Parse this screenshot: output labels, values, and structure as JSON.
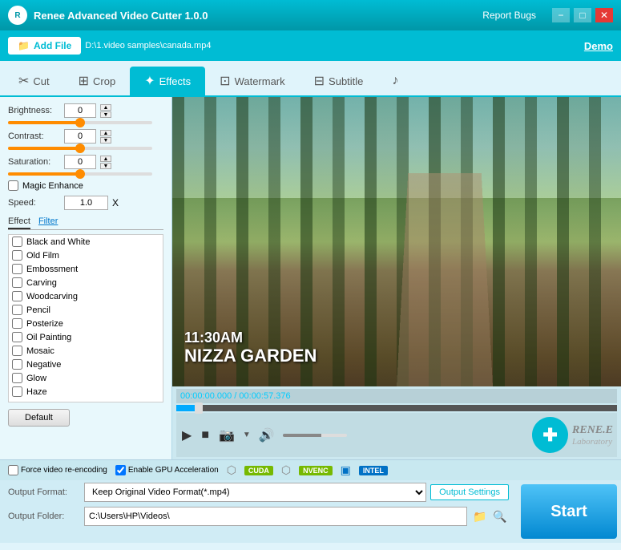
{
  "titlebar": {
    "logo": "R",
    "title": "Renee Advanced Video Cutter 1.0.0",
    "report_bugs": "Report Bugs",
    "minimize": "−",
    "maximize": "□",
    "close": "✕"
  },
  "actionbar": {
    "add_file_label": "Add File",
    "file_path": "D:\\1.video samples\\canada.mp4",
    "demo_label": "Demo"
  },
  "tabs": [
    {
      "id": "cut",
      "label": "Cut",
      "icon": "✂"
    },
    {
      "id": "crop",
      "label": "Crop",
      "icon": "⊞"
    },
    {
      "id": "effects",
      "label": "Effects",
      "icon": "✦",
      "active": true
    },
    {
      "id": "watermark",
      "label": "Watermark",
      "icon": "⊡"
    },
    {
      "id": "subtitle",
      "label": "Subtitle",
      "icon": "⊟"
    },
    {
      "id": "music",
      "label": "",
      "icon": "♪"
    }
  ],
  "left_panel": {
    "brightness": {
      "label": "Brightness:",
      "value": "0"
    },
    "contrast": {
      "label": "Contrast:",
      "value": "0"
    },
    "saturation": {
      "label": "Saturation:",
      "value": "0"
    },
    "magic_enhance": {
      "label": "Magic Enhance",
      "checked": false
    },
    "speed": {
      "label": "Speed:",
      "value": "1.0",
      "unit": "X"
    },
    "effect_tab": "Effect",
    "filter_tab": "Filter",
    "effects_list": [
      {
        "id": "black-white",
        "label": "Black and White",
        "checked": false
      },
      {
        "id": "old-film",
        "label": "Old Film",
        "checked": false
      },
      {
        "id": "embossment",
        "label": "Embossment",
        "checked": false
      },
      {
        "id": "carving",
        "label": "Carving",
        "checked": false
      },
      {
        "id": "woodcarving",
        "label": "Woodcarving",
        "checked": false
      },
      {
        "id": "pencil",
        "label": "Pencil",
        "checked": false
      },
      {
        "id": "posterize",
        "label": "Posterize",
        "checked": false
      },
      {
        "id": "oil-painting",
        "label": "Oil Painting",
        "checked": false
      },
      {
        "id": "mosaic",
        "label": "Mosaic",
        "checked": false
      },
      {
        "id": "negative",
        "label": "Negative",
        "checked": false
      },
      {
        "id": "glow",
        "label": "Glow",
        "checked": false
      },
      {
        "id": "haze",
        "label": "Haze",
        "checked": false
      }
    ],
    "default_btn": "Default"
  },
  "video": {
    "overlay_time": "11:30AM",
    "overlay_location": "NIZZA GARDEN",
    "timecode": "00:00:00.000 / 00:00:57.376"
  },
  "renee": {
    "icon": "✚",
    "name": "RENE.E",
    "sub": "Laboratory"
  },
  "bottom": {
    "force_reencode_label": "Force video re-encoding",
    "gpu_accel_label": "Enable GPU Acceleration",
    "cuda_label": "CUDA",
    "nvenc_label": "NVENC",
    "intel_label": "INTEL",
    "output_format_label": "Output Format:",
    "output_format_value": "Keep Original Video Format(*.mp4)",
    "output_settings_label": "Output Settings",
    "output_folder_label": "Output Folder:",
    "output_folder_value": "C:\\Users\\HP\\Videos\\",
    "start_label": "Start"
  }
}
